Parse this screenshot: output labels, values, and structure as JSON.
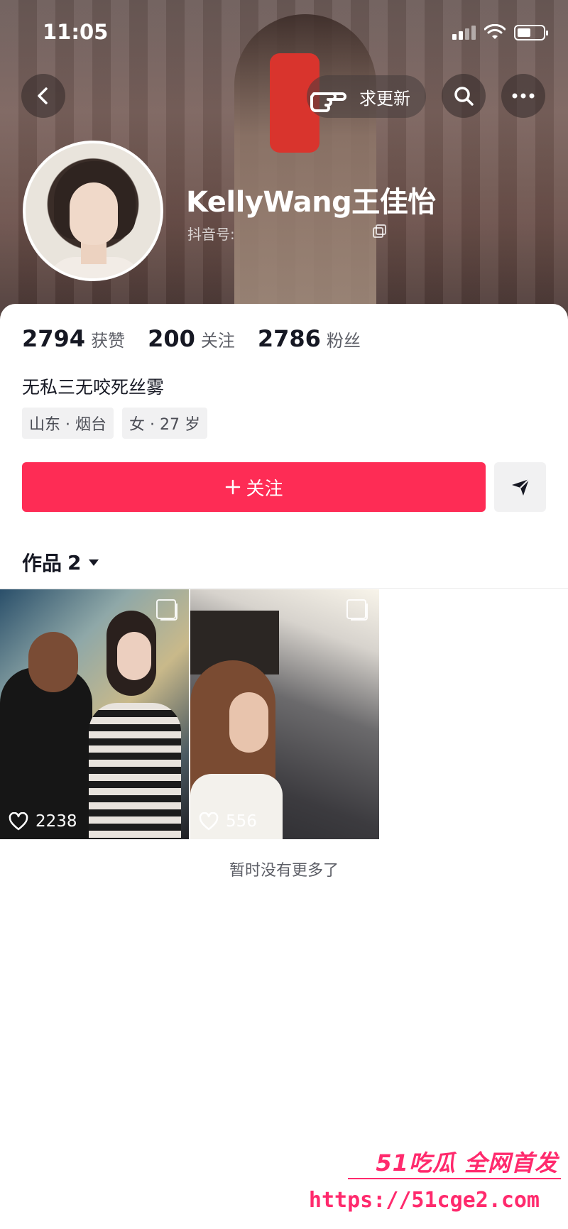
{
  "status_bar": {
    "time": "11:05"
  },
  "header": {
    "request_update_label": "求更新",
    "username": "KellyWang王佳怡",
    "douyin_id_label": "抖音号:"
  },
  "stats": [
    {
      "value": "2794",
      "label": "获赞"
    },
    {
      "value": "200",
      "label": "关注"
    },
    {
      "value": "2786",
      "label": "粉丝"
    }
  ],
  "bio": "无私三无咬死丝雾",
  "tags": [
    "山东 · 烟台",
    "女 · 27 岁"
  ],
  "follow_button": {
    "label": "关注"
  },
  "works": {
    "label": "作品",
    "count": "2",
    "items": [
      {
        "likes": "2238"
      },
      {
        "likes": "556"
      }
    ],
    "no_more_text": "暂时没有更多了"
  },
  "watermark": {
    "line1": "51吃瓜 全网首发",
    "line2": "https://51cge2.com"
  },
  "colors": {
    "accent": "#fe2c55",
    "text": "#161823",
    "secondary": "#5c5e66"
  }
}
